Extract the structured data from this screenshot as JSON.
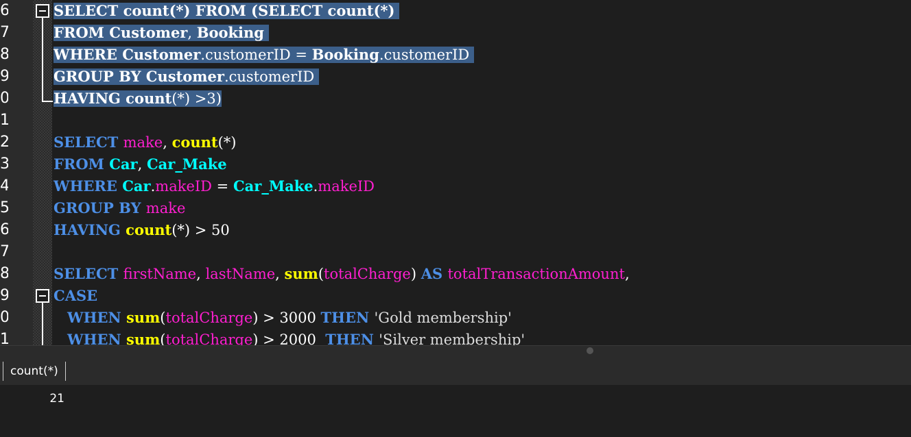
{
  "editor": {
    "line_numbers": [
      "6",
      "7",
      "8",
      "9",
      "0",
      "1",
      "2",
      "3",
      "4",
      "5",
      "6",
      "7",
      "8",
      "9",
      "0",
      "1"
    ],
    "lines": [
      {
        "selected": true,
        "tokens": [
          {
            "t": "SELECT count(*) FROM (SELECT count(*)",
            "c": "bold"
          },
          {
            "t": " ",
            "c": "txt"
          }
        ]
      },
      {
        "selected": true,
        "tokens": [
          {
            "t": "FROM Customer",
            "c": "bold"
          },
          {
            "t": ", ",
            "c": "txt"
          },
          {
            "t": "Booking",
            "c": "bold"
          },
          {
            "t": " ",
            "c": "txt"
          }
        ]
      },
      {
        "selected": true,
        "tokens": [
          {
            "t": "WHERE Customer",
            "c": "bold"
          },
          {
            "t": ".customerID = ",
            "c": "txt"
          },
          {
            "t": "Booking",
            "c": "bold"
          },
          {
            "t": ".customerID ",
            "c": "txt"
          }
        ]
      },
      {
        "selected": true,
        "tokens": [
          {
            "t": "GROUP BY Customer",
            "c": "bold"
          },
          {
            "t": ".customerID ",
            "c": "txt"
          }
        ]
      },
      {
        "selected": true,
        "tokens": [
          {
            "t": "HAVING count",
            "c": "bold"
          },
          {
            "t": "(*) >3)",
            "c": "txt"
          }
        ]
      },
      {
        "selected": false,
        "tokens": []
      },
      {
        "selected": false,
        "tokens": [
          {
            "t": "SELECT ",
            "c": "kw"
          },
          {
            "t": "make",
            "c": "col"
          },
          {
            "t": ", ",
            "c": "txt"
          },
          {
            "t": "count",
            "c": "fn"
          },
          {
            "t": "(*)",
            "c": "txt"
          }
        ]
      },
      {
        "selected": false,
        "tokens": [
          {
            "t": "FROM ",
            "c": "kw"
          },
          {
            "t": "Car",
            "c": "tbl"
          },
          {
            "t": ", ",
            "c": "txt"
          },
          {
            "t": "Car_Make",
            "c": "tbl"
          }
        ]
      },
      {
        "selected": false,
        "tokens": [
          {
            "t": "WHERE ",
            "c": "kw"
          },
          {
            "t": "Car",
            "c": "tbl"
          },
          {
            "t": ".",
            "c": "txt"
          },
          {
            "t": "makeID",
            "c": "col"
          },
          {
            "t": " = ",
            "c": "txt"
          },
          {
            "t": "Car_Make",
            "c": "tbl"
          },
          {
            "t": ".",
            "c": "txt"
          },
          {
            "t": "makeID",
            "c": "col"
          }
        ]
      },
      {
        "selected": false,
        "tokens": [
          {
            "t": "GROUP BY ",
            "c": "kw"
          },
          {
            "t": "make",
            "c": "col"
          }
        ]
      },
      {
        "selected": false,
        "tokens": [
          {
            "t": "HAVING ",
            "c": "kw"
          },
          {
            "t": "count",
            "c": "fn"
          },
          {
            "t": "(*) > 50",
            "c": "txt"
          }
        ]
      },
      {
        "selected": false,
        "tokens": []
      },
      {
        "selected": false,
        "tokens": [
          {
            "t": "SELECT ",
            "c": "kw"
          },
          {
            "t": "firstName",
            "c": "col"
          },
          {
            "t": ", ",
            "c": "txt"
          },
          {
            "t": "lastName",
            "c": "col"
          },
          {
            "t": ", ",
            "c": "txt"
          },
          {
            "t": "sum",
            "c": "fn"
          },
          {
            "t": "(",
            "c": "txt"
          },
          {
            "t": "totalCharge",
            "c": "col"
          },
          {
            "t": ") ",
            "c": "txt"
          },
          {
            "t": "AS ",
            "c": "kw"
          },
          {
            "t": "totalTransactionAmount",
            "c": "col"
          },
          {
            "t": ",",
            "c": "txt"
          }
        ]
      },
      {
        "selected": false,
        "tokens": [
          {
            "t": "CASE",
            "c": "kw"
          }
        ]
      },
      {
        "selected": false,
        "tokens": [
          {
            "t": "   ",
            "c": "txt"
          },
          {
            "t": "WHEN ",
            "c": "kw"
          },
          {
            "t": "sum",
            "c": "fn"
          },
          {
            "t": "(",
            "c": "txt"
          },
          {
            "t": "totalCharge",
            "c": "col"
          },
          {
            "t": ") > 3000 ",
            "c": "txt"
          },
          {
            "t": "THEN ",
            "c": "kw"
          },
          {
            "t": "'Gold membership'",
            "c": "str"
          }
        ]
      },
      {
        "selected": false,
        "tokens": [
          {
            "t": "   ",
            "c": "txt"
          },
          {
            "t": "WHEN ",
            "c": "kw"
          },
          {
            "t": "sum",
            "c": "fn"
          },
          {
            "t": "(",
            "c": "txt"
          },
          {
            "t": "totalCharge",
            "c": "col"
          },
          {
            "t": ") > 2000  ",
            "c": "txt"
          },
          {
            "t": "THEN ",
            "c": "kw"
          },
          {
            "t": "'Silver membership'",
            "c": "str"
          }
        ]
      }
    ]
  },
  "results": {
    "columns": [
      "count(*)"
    ],
    "rows": [
      [
        "21"
      ]
    ]
  }
}
